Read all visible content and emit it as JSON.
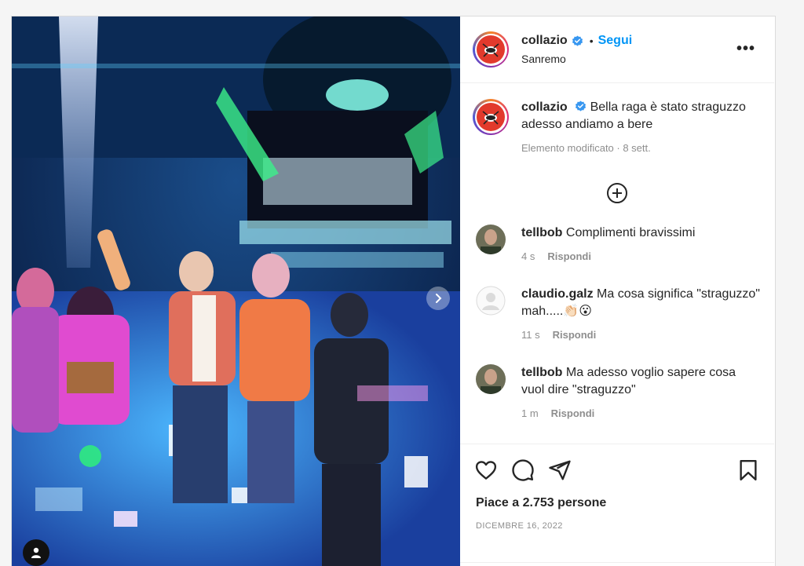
{
  "header": {
    "username": "collazio",
    "follow_label": "Segui",
    "separator": "•",
    "location": "Sanremo",
    "more_label": "•••"
  },
  "caption": {
    "username": "collazio",
    "text": "Bella raga è stato straguzzo adesso andiamo a bere",
    "meta": "Elemento modificato · 8 sett."
  },
  "comments": [
    {
      "username": "tellbob",
      "text": "Complimenti bravissimi",
      "time": "4 s",
      "reply": "Rispondi"
    },
    {
      "username": "claudio.galz",
      "text": "Ma cosa significa \"straguzzo\" mah.....👏🏻😮",
      "time": "11 s",
      "reply": "Rispondi"
    },
    {
      "username": "tellbob",
      "text": "Ma adesso voglio sapere cosa vuol dire \"straguzzo\"",
      "time": "1 m",
      "reply": "Rispondi"
    }
  ],
  "actions": {
    "icons": [
      "heart-icon",
      "comment-icon",
      "share-icon",
      "bookmark-icon"
    ]
  },
  "likes": "Piace a 2.753 persone",
  "date": "DICEMBRE 16, 2022",
  "colors": {
    "accent": "#0095f6",
    "verified": "#3897f0",
    "muted": "#8e8e8e"
  }
}
